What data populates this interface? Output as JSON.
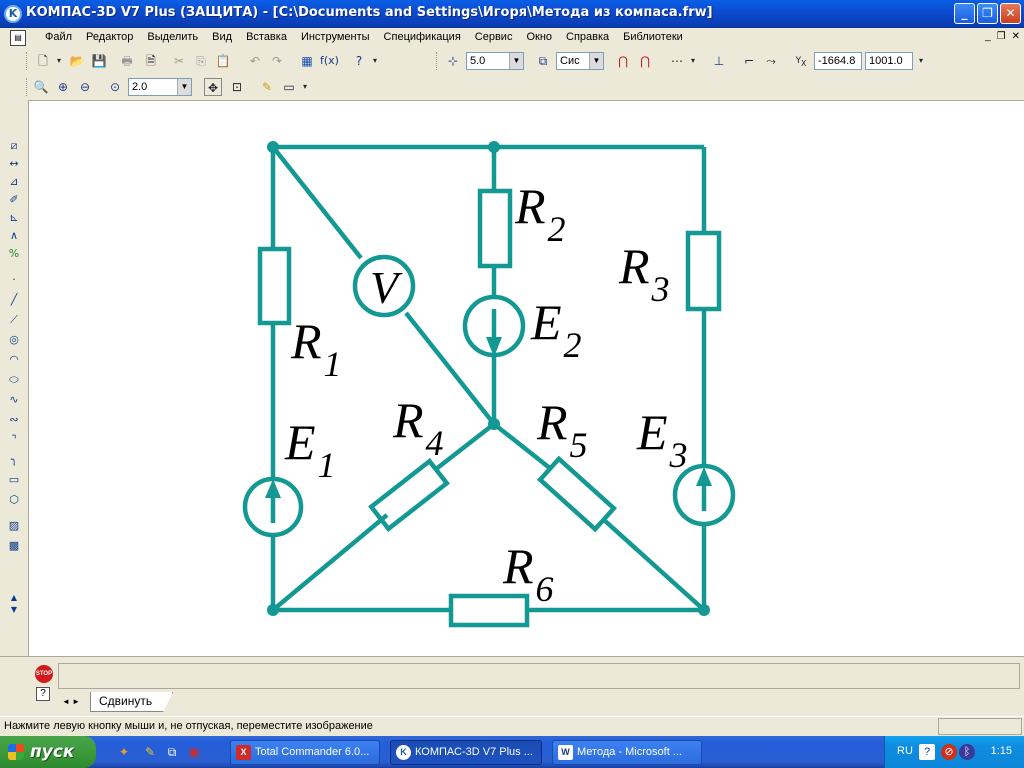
{
  "window": {
    "title": "КОМПАС-3D V7 Plus (ЗАЩИТА) - [C:\\Documents and Settings\\Игоря\\Метода из компаса.frw]",
    "app_icon": "kompas-logo-icon"
  },
  "menu": {
    "items": [
      "Файл",
      "Редактор",
      "Выделить",
      "Вид",
      "Вставка",
      "Инструменты",
      "Спецификация",
      "Сервис",
      "Окно",
      "Справка",
      "Библиотеки"
    ]
  },
  "toolbar1": {
    "step_value": "5.0",
    "layer_value": "Сис",
    "coord_x": "-1664.8",
    "coord_y": "1001.0",
    "coord_label": "X"
  },
  "toolbar2": {
    "zoom_value": "2.0"
  },
  "schematic": {
    "labels": {
      "R1": {
        "main": "R",
        "sub": "1"
      },
      "R2": {
        "main": "R",
        "sub": "2"
      },
      "R3": {
        "main": "R",
        "sub": "3"
      },
      "R4": {
        "main": "R",
        "sub": "4"
      },
      "R5": {
        "main": "R",
        "sub": "5"
      },
      "R6": {
        "main": "R",
        "sub": "6"
      },
      "E1": {
        "main": "E",
        "sub": "1"
      },
      "E2": {
        "main": "E",
        "sub": "2"
      },
      "E3": {
        "main": "E",
        "sub": "3"
      },
      "V": "V"
    },
    "wire_color": "#139893"
  },
  "bottom": {
    "stop_label": "STOP",
    "help_label": "?",
    "tab_label": "Сдвинуть"
  },
  "status": {
    "hint": "Нажмите левую кнопку мыши и, не отпуская, переместите изображение"
  },
  "taskbar": {
    "start_label": "пуск",
    "tasks": [
      {
        "label": "Total Commander 6.0...",
        "icon": "total-commander-icon"
      },
      {
        "label": "КОМПАС-3D V7 Plus ...",
        "icon": "kompas-icon"
      },
      {
        "label": "Метода - Microsoft ...",
        "icon": "word-icon"
      }
    ],
    "tray_lang": "RU",
    "clock": "1:15"
  }
}
